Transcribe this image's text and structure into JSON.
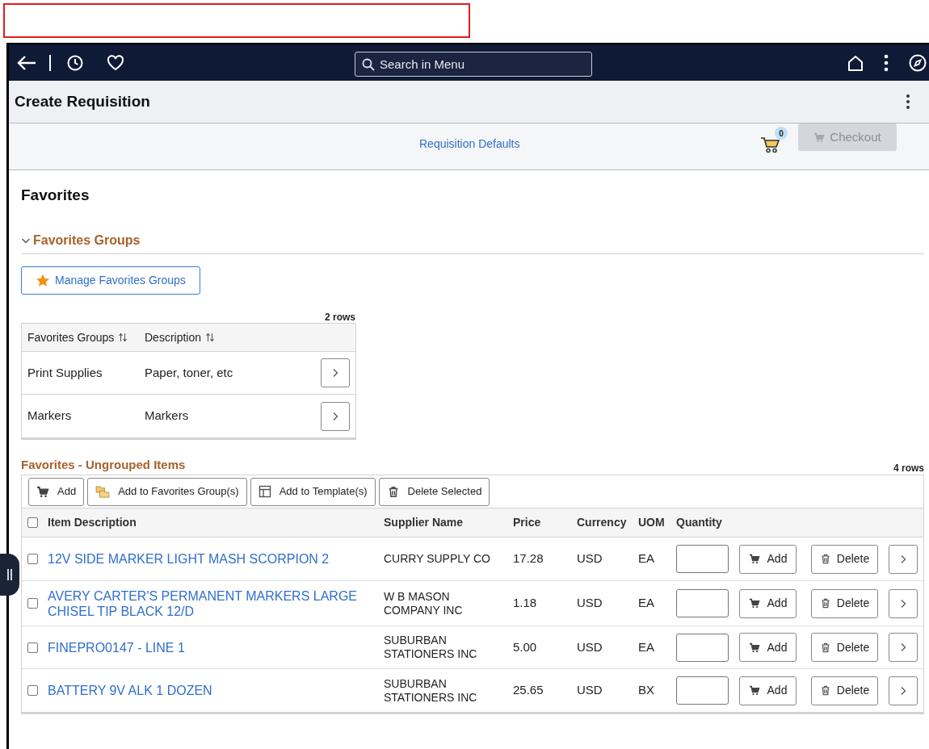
{
  "header": {
    "search": {
      "placeholder": "Search in Menu"
    }
  },
  "page_title": "Create Requisition",
  "defaults_link": "Requisition Defaults",
  "cart": {
    "count": "0"
  },
  "checkout": {
    "label": "Checkout",
    "disabled": true
  },
  "section_title": "Favorites",
  "groups": {
    "title": "Favorites Groups",
    "expanded": true,
    "manage_button": "Manage Favorites Groups",
    "row_count": "2 rows",
    "columns": [
      "Favorites Groups",
      "Description"
    ],
    "rows": [
      {
        "group": "Print Supplies",
        "description": "Paper, toner, etc"
      },
      {
        "group": "Markers",
        "description": "Markers"
      }
    ]
  },
  "items": {
    "title": "Favorites - Ungrouped Items",
    "row_count": "4 rows",
    "toolbar": [
      {
        "kind": "cart",
        "label": "Add"
      },
      {
        "kind": "folders",
        "label": "Add to Favorites Group(s)"
      },
      {
        "kind": "template",
        "label": "Add to Template(s)"
      },
      {
        "kind": "trash",
        "label": "Delete Selected"
      }
    ],
    "select_all_checked": false,
    "columns": [
      "Item Description",
      "Supplier Name",
      "Price",
      "Currency",
      "UOM",
      "Quantity"
    ],
    "rows": [
      {
        "checked": false,
        "add_label": "Add",
        "delete_label": "Delete",
        "description": "12V SIDE MARKER LIGHT MASH SCORPION 2",
        "supplier": "CURRY SUPPLY CO",
        "price": "17.28",
        "currency": "USD",
        "uom": "EA"
      },
      {
        "checked": false,
        "add_label": "Add",
        "delete_label": "Delete",
        "description": "AVERY CARTER'S PERMANENT MARKERS LARGE CHISEL TIP BLACK 12/D",
        "supplier": "W B MASON COMPANY INC",
        "price": "1.18",
        "currency": "USD",
        "uom": "EA"
      },
      {
        "checked": false,
        "add_label": "Add",
        "delete_label": "Delete",
        "description": "FINEPRO0147 - LINE 1",
        "supplier": "SUBURBAN STATIONERS INC",
        "price": "5.00",
        "currency": "USD",
        "uom": "EA"
      },
      {
        "checked": false,
        "add_label": "Add",
        "delete_label": "Delete",
        "description": "BATTERY 9V ALK 1 DOZEN",
        "supplier": "SUBURBAN STATIONERS INC",
        "price": "25.65",
        "currency": "USD",
        "uom": "BX"
      }
    ]
  }
}
